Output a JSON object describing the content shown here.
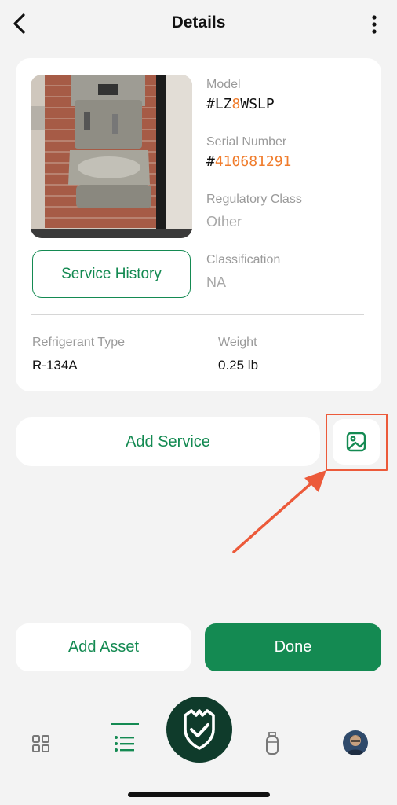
{
  "header": {
    "title": "Details"
  },
  "asset": {
    "model_label": "Model",
    "model_prefix": "#LZ",
    "model_highlight": "8",
    "model_suffix": "WSLP",
    "serial_label": "Serial Number",
    "serial_prefix": "#",
    "serial_value": "410681291",
    "regulatory_label": "Regulatory Class",
    "regulatory_value": "Other",
    "classification_label": "Classification",
    "classification_value": "NA",
    "refrigerant_label": "Refrigerant Type",
    "refrigerant_value": "R-134A",
    "weight_label": "Weight",
    "weight_value": "0.25 lb",
    "service_history_label": "Service History"
  },
  "actions": {
    "add_service": "Add Service",
    "add_asset": "Add Asset",
    "done": "Done"
  },
  "nav": {
    "items": [
      "dashboard-grid-icon",
      "list-icon",
      "shield-check-icon",
      "cylinder-icon",
      "profile-avatar"
    ],
    "active": "list-icon"
  },
  "colors": {
    "accent_green": "#148a52",
    "highlight_orange": "#f07c2c",
    "annotation_red": "#ec5a3a",
    "fab_dark": "#0f3b2b"
  }
}
